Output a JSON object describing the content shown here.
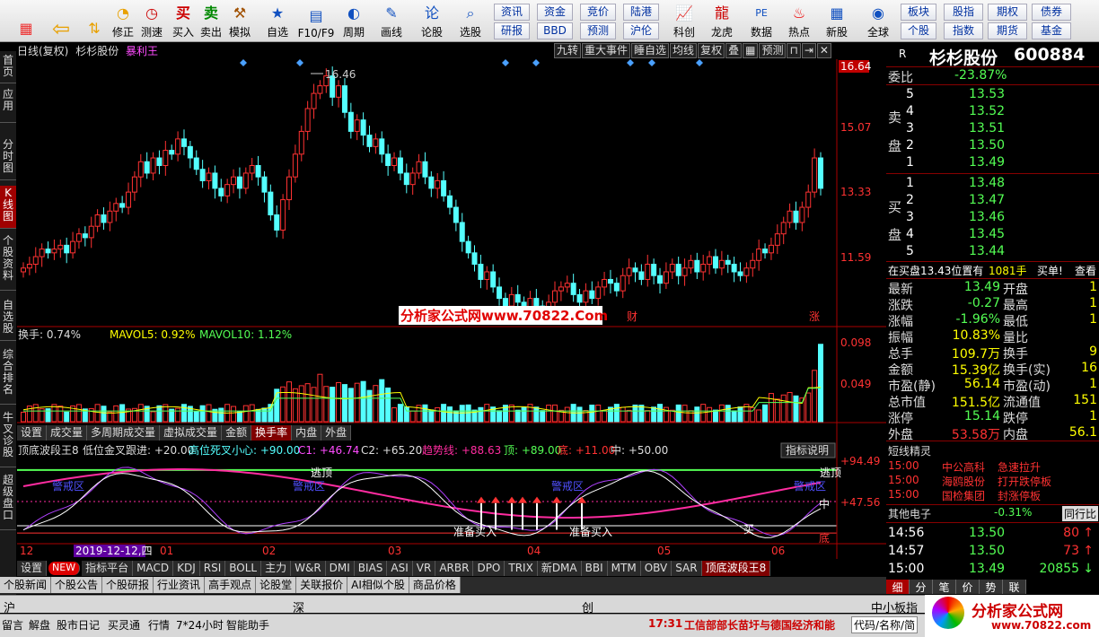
{
  "toolbar": {
    "items": [
      {
        "label": ""
      },
      {
        "label": ""
      },
      {
        "label": "修正"
      },
      {
        "label": "测速"
      },
      {
        "label": "买入"
      },
      {
        "label": "卖出"
      },
      {
        "label": "模拟"
      },
      {
        "label": "自选"
      },
      {
        "label": "F10/F9"
      },
      {
        "label": "周期"
      },
      {
        "label": "画线"
      },
      {
        "label": "论股"
      },
      {
        "label": "选股"
      }
    ],
    "small_buttons": [
      "资讯",
      "资金",
      "竞价",
      "陆港",
      "研报",
      "BBD",
      "预测",
      "沪伦"
    ],
    "big_items": [
      "科创",
      "龙虎",
      "数据",
      "热点",
      "新股"
    ],
    "right_items": [
      "全球"
    ],
    "right_small": [
      "板块",
      "股指",
      "期权",
      "债券",
      "个股",
      "指数",
      "期货",
      "基金"
    ]
  },
  "left_tabs": [
    "首页",
    "应用",
    "分时图",
    "K线图",
    "个股资料",
    "自选股",
    "综合排名",
    "牛叉诊股",
    "超级盘口"
  ],
  "chart": {
    "header": {
      "period": "日线(复权)",
      "stock": "杉杉股份",
      "indicator": "暴利王"
    },
    "top_buttons": [
      "九转",
      "重大事件",
      "睡自选",
      "均线",
      "复权",
      "叠",
      "预测"
    ],
    "price_labels": [
      "16.64",
      "15.07",
      "13.33",
      "11.59"
    ],
    "peak_label": "16.46",
    "watermark": "分析家公式网www.70822.Com",
    "events": [
      "财",
      "涨"
    ],
    "turnover_header": {
      "name": "换手: 0.74%",
      "mavol5": "MAVOL5: 0.92%",
      "mavol10": "MAVOL10: 1.12%"
    },
    "turnover_labels": [
      "0.098",
      "0.049"
    ],
    "mid_tabs": [
      "设置",
      "成交量",
      "多周期成交量",
      "虚拟成交量",
      "金额",
      "换手率",
      "内盘",
      "外盘"
    ],
    "indicator_header": {
      "name": "顶底波段王8",
      "low": "低位金叉跟进: +20.00",
      "high": "高位死叉小心: +90.00",
      "c1": "C1: +46.74",
      "c2": "C2: +65.20",
      "trend": "趋势线: +88.63",
      "top": "顶: +89.00",
      "bottom": "底: +11.00",
      "mid": "中: +50.00",
      "help": "指标说明"
    },
    "indicator_labels": [
      "+94.49",
      "+47.56"
    ],
    "indicator_annotations": {
      "escape": "逃顶",
      "warn": "警戒区",
      "buy_ready": "准备买入",
      "buy": "买",
      "mid": "中",
      "bottom": "底",
      "escape_r": "逃顶"
    },
    "x_axis": [
      "12",
      "2019-12-12,四",
      "01",
      "02",
      "03",
      "04",
      "05",
      "06"
    ],
    "bottom_tabs": [
      "设置",
      "NEW",
      "指标平台",
      "MACD",
      "KDJ",
      "RSI",
      "BOLL",
      "主力",
      "W&R",
      "DMI",
      "BIAS",
      "ASI",
      "VR",
      "ARBR",
      "DPO",
      "TRIX",
      "新DMA",
      "BBI",
      "MTM",
      "OBV",
      "SAR",
      "顶底波段王8"
    ]
  },
  "info_tabs": [
    "个股新闻",
    "个股公告",
    "个股研报",
    "行业资讯",
    "高手观点",
    "论股堂",
    "关联报价",
    "AI相似个股",
    "商品价格"
  ],
  "quote": {
    "flag": "R",
    "name": "杉杉股份",
    "code": "600884",
    "wei_bi_label": "委比",
    "wei_bi": "-23.87%",
    "sell_label": [
      "卖",
      "盘"
    ],
    "buy_label": [
      "买",
      "盘"
    ],
    "sells": [
      {
        "lvl": "5",
        "price": "13.53"
      },
      {
        "lvl": "4",
        "price": "13.52"
      },
      {
        "lvl": "3",
        "price": "13.51"
      },
      {
        "lvl": "2",
        "price": "13.50"
      },
      {
        "lvl": "1",
        "price": "13.49"
      }
    ],
    "buys": [
      {
        "lvl": "1",
        "price": "13.48"
      },
      {
        "lvl": "2",
        "price": "13.47"
      },
      {
        "lvl": "3",
        "price": "13.46"
      },
      {
        "lvl": "4",
        "price": "13.45"
      },
      {
        "lvl": "5",
        "price": "13.44"
      }
    ],
    "order_line": "在买盘13.43位置有",
    "order_qty": "1081手",
    "order_tag": "买单!",
    "order_more": "查看",
    "stats": [
      {
        "k": "最新",
        "v": "13.49",
        "k2": "开盘",
        "v2": "1"
      },
      {
        "k": "涨跌",
        "v": "-0.27",
        "k2": "最高",
        "v2": "1"
      },
      {
        "k": "涨幅",
        "v": "-1.96%",
        "k2": "最低",
        "v2": "1"
      },
      {
        "k": "振幅",
        "v": "10.83%",
        "k2": "量比",
        "v2": ""
      },
      {
        "k": "总手",
        "v": "109.7万",
        "k2": "换手",
        "v2": "9"
      },
      {
        "k": "金额",
        "v": "15.39亿",
        "k2": "换手(实)",
        "v2": "16"
      },
      {
        "k": "市盈(静)",
        "v": "56.14",
        "k2": "市盈(动)",
        "v2": "1"
      },
      {
        "k": "总市值",
        "v": "151.5亿",
        "k2": "流通值",
        "v2": "151"
      },
      {
        "k": "涨停",
        "v": "15.14",
        "k2": "跌停",
        "v2": "1"
      },
      {
        "k": "外盘",
        "v": "53.58万",
        "k2": "内盘",
        "v2": "56.1"
      }
    ],
    "spirit_title": "短线精灵",
    "spirit": [
      {
        "t": "15:00",
        "n": "中公高科",
        "e": "急速拉升"
      },
      {
        "t": "15:00",
        "n": "海鸥股份",
        "e": "打开跌停板"
      },
      {
        "t": "15:00",
        "n": "国检集团",
        "e": "封涨停板"
      }
    ],
    "sector": {
      "name": "其他电子",
      "pct": "-0.31%",
      "tag": "同行比"
    },
    "ticks": [
      {
        "t": "14:56",
        "p": "13.50",
        "v": "80"
      },
      {
        "t": "14:57",
        "p": "13.50",
        "v": "73"
      },
      {
        "t": "15:00",
        "p": "13.49",
        "v": "20855"
      }
    ],
    "tick_tabs": [
      "细",
      "分",
      "笔",
      "价",
      "势",
      "联"
    ]
  },
  "status1": [
    "沪",
    "深",
    "创",
    "中小板指"
  ],
  "status2": {
    "items": [
      "留言",
      "解盘",
      "股市日记",
      "买灵通",
      "行情",
      "7*24小时",
      "智能助手"
    ],
    "news_time": "17:31",
    "news": "工信部部长苗圩与德国经济和能",
    "code_input": "代码/名称/简",
    "logo": "分析家公式网",
    "logo_url": "www.70822.com"
  },
  "colors": {
    "up": "#ff3232",
    "down": "#54ffff",
    "yellow": "#ffff00",
    "magenta": "#ff2ca0"
  }
}
